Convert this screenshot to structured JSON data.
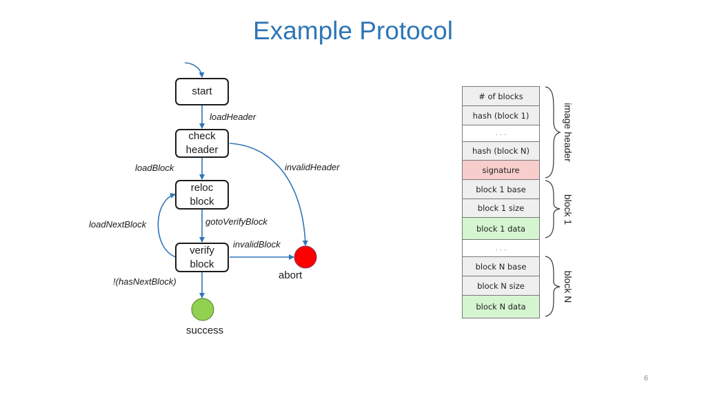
{
  "slide": {
    "title": "Example Protocol",
    "page_number": "6"
  },
  "state_machine": {
    "states": {
      "start": "start",
      "check_header": "check\nheader",
      "reloc_block": "reloc\nblock",
      "verify_block": "verify\nblock"
    },
    "terminals": {
      "success": "success",
      "abort": "abort"
    },
    "terminal_colors": {
      "success": "#92d050",
      "abort": "#ff0000"
    },
    "edge_color": "#2e75b6",
    "transitions": {
      "load_header": "loadHeader",
      "load_block": "loadBlock",
      "invalid_header": "invalidHeader",
      "goto_verify_block": "gotoVerifyBlock",
      "load_next_block": "loadNextBlock",
      "invalid_block": "invalidBlock",
      "no_next_block": "!(hasNextBlock)"
    }
  },
  "image_layout": {
    "rows": [
      {
        "label": "# of blocks",
        "kind": "field"
      },
      {
        "label": "hash (block 1)",
        "kind": "field"
      },
      {
        "label": ". . .",
        "kind": "ellipsis"
      },
      {
        "label": "hash (block N)",
        "kind": "field"
      },
      {
        "label": "signature",
        "kind": "signature"
      },
      {
        "label": "block 1 base",
        "kind": "field"
      },
      {
        "label": "block 1 size",
        "kind": "field"
      },
      {
        "label": "block 1 data",
        "kind": "data"
      },
      {
        "label": ". . .",
        "kind": "ellipsis"
      },
      {
        "label": "block N base",
        "kind": "field"
      },
      {
        "label": "block N size",
        "kind": "field"
      },
      {
        "label": "block N data",
        "kind": "data"
      }
    ],
    "row_colors": {
      "field": "#efefef",
      "ellipsis": "#ffffff",
      "signature": "#f8cecc",
      "data": "#d5f5d0"
    },
    "groups": {
      "image_header": "image header",
      "block_1": "block 1",
      "block_n": "block N"
    }
  }
}
